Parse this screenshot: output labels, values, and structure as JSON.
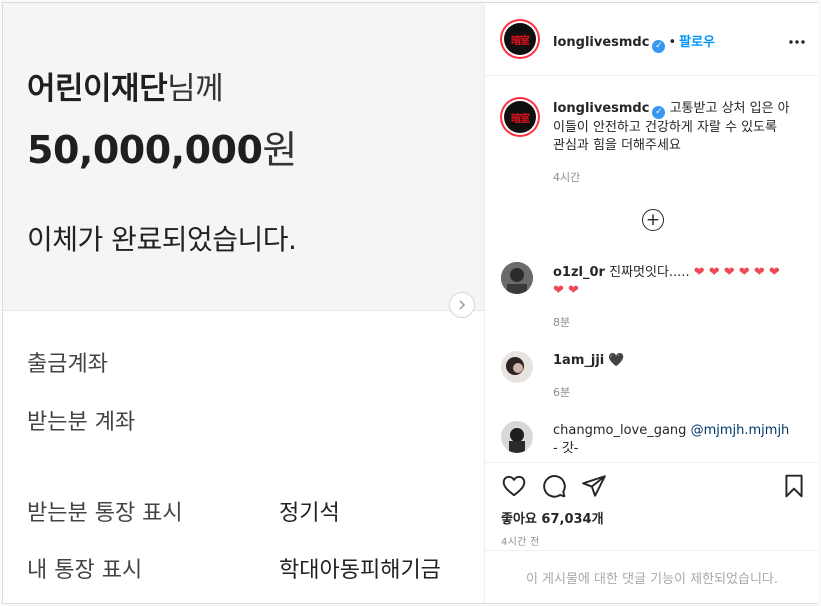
{
  "post_image": {
    "recipient": "어린이재단",
    "recipient_honorific": "님께",
    "amount": "50,000,000",
    "amount_unit": "원",
    "status": "이체가 완료되었습니다.",
    "rows": [
      {
        "label": "출금계좌",
        "value": ""
      },
      {
        "label": "받는분 계좌",
        "value": ""
      },
      {
        "label": "받는분 통장 표시",
        "value": "정기석"
      },
      {
        "label": "내 통장 표시",
        "value": "학대아동피해기금"
      }
    ],
    "next_icon": "chevron-right-icon"
  },
  "header": {
    "username": "longlivesmdc",
    "separator": "•",
    "follow_label": "팔로우",
    "more_icon": "more-horizontal-icon",
    "logo_text": "暗室"
  },
  "caption": {
    "username": "longlivesmdc",
    "text": "고통받고 상처 입은 아이들이 안전하고 건강하게 자랄 수 있도록 관심과 힘을 더해주세요",
    "time": "4시간"
  },
  "load_more_icon": "plus-circle-icon",
  "comments": [
    {
      "username": "o1zl_0r",
      "text": "진짜멋잇다.....",
      "hearts": "❤ ❤ ❤ ❤ ❤ ❤ ❤ ❤",
      "time": "8분"
    },
    {
      "username": "1am_jji",
      "text": "",
      "hearts": "🖤",
      "time": "6분"
    },
    {
      "username": "changmo_love_gang",
      "mention": "@mjmjh.mjmjh",
      "text": "- 갓-",
      "time": ""
    }
  ],
  "actions": {
    "like_icon": "heart-icon",
    "comment_icon": "comment-icon",
    "share_icon": "paper-plane-icon",
    "save_icon": "bookmark-icon",
    "likes_label": "좋아요",
    "likes_count": "67,034개",
    "timestamp": "4시간 전"
  },
  "footer": {
    "notice": "이 게시물에 대한 댓글 기능이 제한되었습니다."
  },
  "colors": {
    "follow": "#0095f6",
    "verified": "#3897f0",
    "heart": "#ed4956",
    "story_ring": "#ff3040"
  }
}
